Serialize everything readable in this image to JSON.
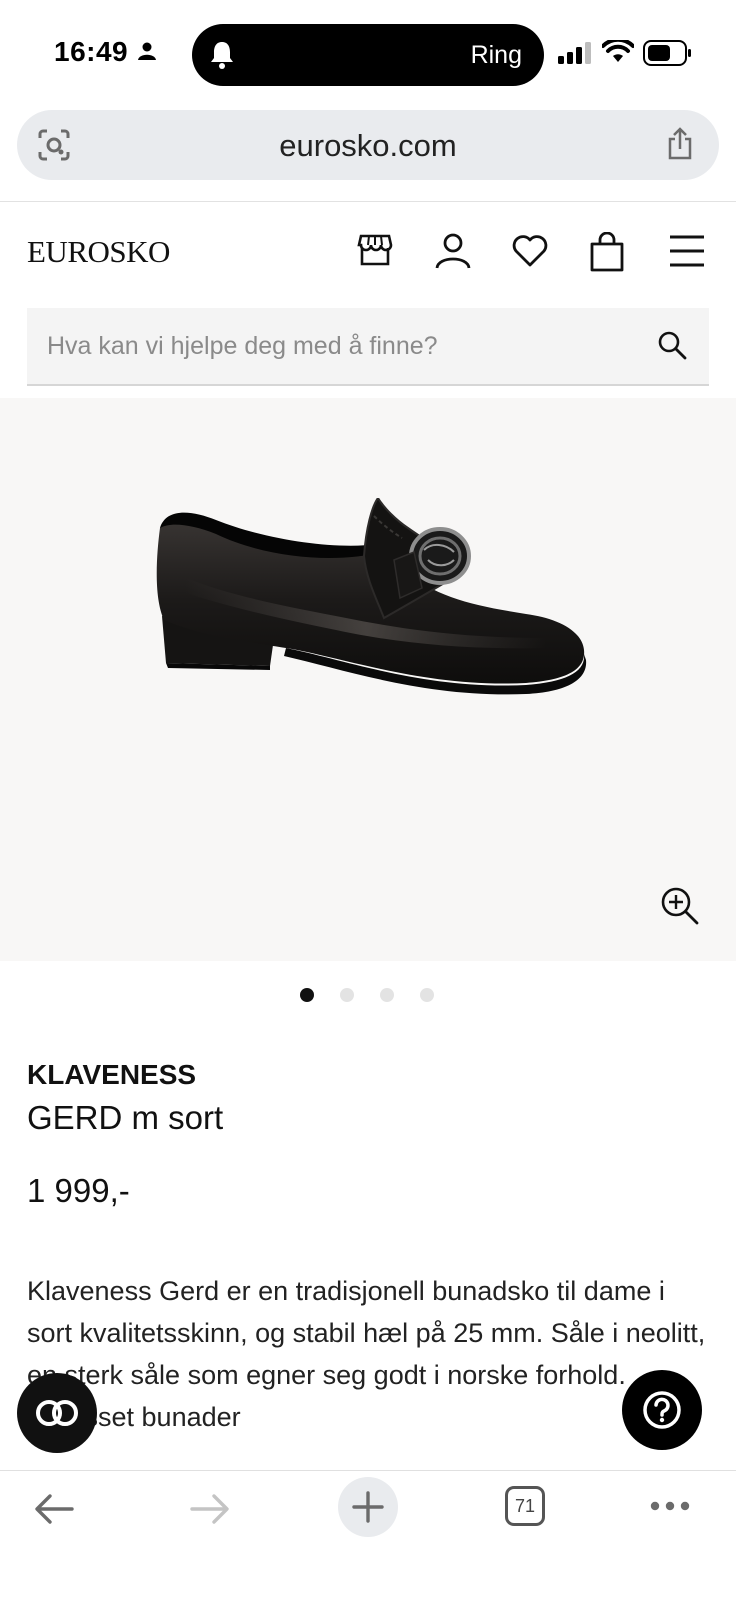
{
  "status_bar": {
    "time": "16:49",
    "island_label": "Ring"
  },
  "browser": {
    "url": "eurosko.com",
    "tab_count": "71"
  },
  "site": {
    "logo": "EUROSKO",
    "search_placeholder": "Hva kan vi hjelpe deg med å finne?"
  },
  "product": {
    "brand": "KLAVENESS",
    "name": "GERD m sort",
    "price": "1 999,-",
    "description": "Klaveness Gerd er en tradisjonell bunadsko til dame i sort kvalitetsskinn, og stabil hæl på 25 mm. Såle i neolitt, en sterk såle som egner seg godt i norske forhold. Tilpasset bunader",
    "image_count": 4,
    "active_image": 1
  },
  "icons": {
    "header": [
      "store-icon",
      "account-icon",
      "heart-icon",
      "bag-icon",
      "menu-icon"
    ],
    "toolbar": [
      "back-icon",
      "forward-icon",
      "plus-icon",
      "tabs-icon",
      "more-icon"
    ]
  },
  "colors": {
    "background": "#ffffff",
    "image_bg": "#f8f7f6",
    "accent": "#111111"
  }
}
